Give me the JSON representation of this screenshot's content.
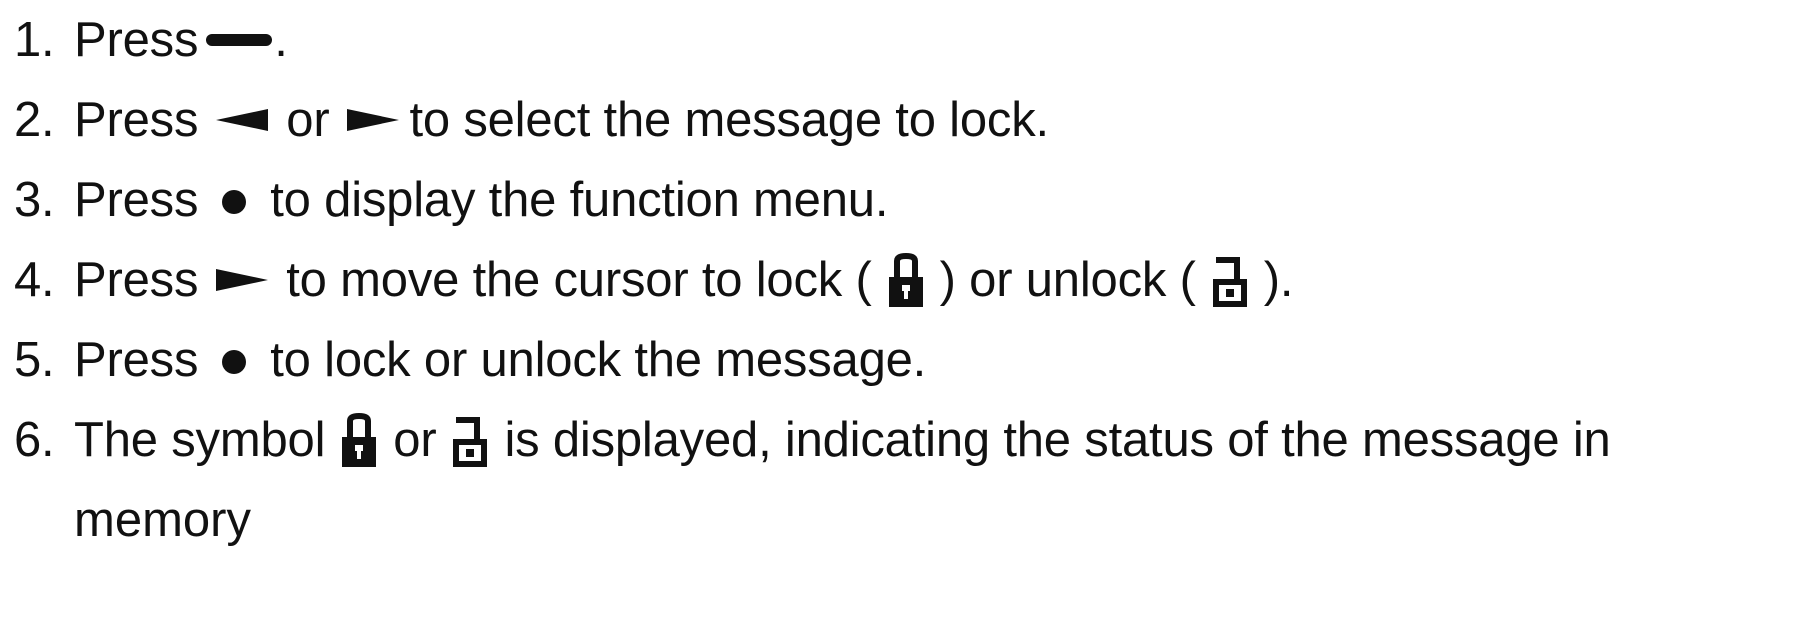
{
  "steps": [
    {
      "number": "1.",
      "parts": {
        "a": "Press",
        "icon1": "dash-button-icon",
        "b": "."
      }
    },
    {
      "number": "2.",
      "parts": {
        "a": "Press",
        "icon1": "left-arrow-icon",
        "b": "or",
        "icon2": "right-arrow-icon",
        "c": "to select the message to lock."
      }
    },
    {
      "number": "3.",
      "parts": {
        "a": "Press",
        "icon1": "dot-button-icon",
        "b": "to display the function menu."
      }
    },
    {
      "number": "4.",
      "parts": {
        "a": "Press",
        "icon1": "right-arrow-icon",
        "b": "to move the cursor to lock (",
        "icon2": "lock-closed-icon",
        "c": ") or unlock (",
        "icon3": "lock-open-icon",
        "d": ")."
      }
    },
    {
      "number": "5.",
      "parts": {
        "a": "Press",
        "icon1": "dot-button-icon",
        "b": "to lock or unlock the message."
      }
    },
    {
      "number": "6.",
      "parts": {
        "a": "The symbol",
        "icon1": "lock-closed-icon",
        "b": "or",
        "icon2": "lock-open-icon",
        "c": "is displayed, indicating the status of the message in",
        "continuation": "memory"
      }
    }
  ],
  "colors": {
    "text": "#111111",
    "background": "#ffffff"
  }
}
